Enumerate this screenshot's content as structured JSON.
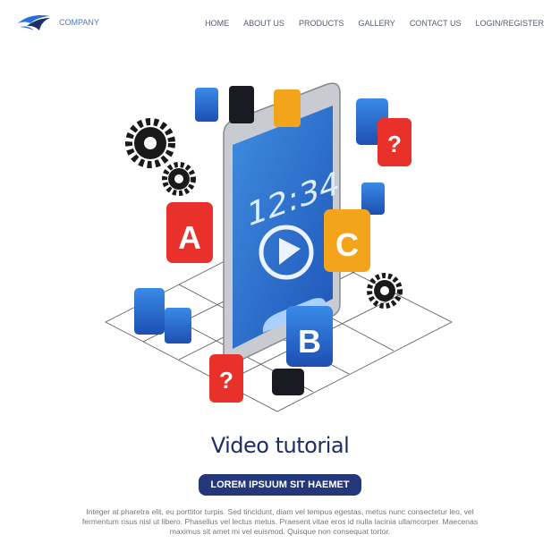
{
  "brand": {
    "name": "COMPANY"
  },
  "nav": {
    "items": [
      "HOME",
      "ABOUT US",
      "PRODUCTS",
      "GALLERY",
      "CONTACT US",
      "LOGIN/REGISTER"
    ]
  },
  "illustration": {
    "phone_time": "12:34",
    "cubes": {
      "a": "A",
      "b": "B",
      "c": "C",
      "q": "?"
    },
    "colors": {
      "blue": "#2a6fd6",
      "red": "#e8312a",
      "orange": "#f4a41a",
      "dark": "#1a1a22",
      "navy": "#24377a"
    }
  },
  "hero": {
    "title": "Video tutorial",
    "cta_label": "LOREM IPSUUM SIT HAEMET",
    "body": "Integer at pharetra elit, eu porttitor turpis. Sed tincidunt, diam vel tempus egestas, metus nunc consectetur leo, vel fermentum risus nisl ut libero. Phasellus vel lectus metus. Praesent vitae eros id nulla lacinia ullamcorper. Maecenas maximus sit amet mi vel euismod. Quisque non consequat tortor."
  }
}
